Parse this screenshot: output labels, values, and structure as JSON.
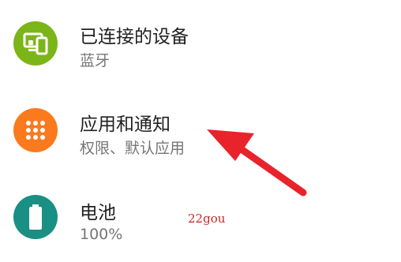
{
  "settings": {
    "items": [
      {
        "title": "已连接的设备",
        "subtitle": "蓝牙",
        "icon": "connected-devices-icon",
        "color": "#7cb518"
      },
      {
        "title": "应用和通知",
        "subtitle": "权限、默认应用",
        "icon": "apps-grid-icon",
        "color": "#fb7a1e"
      },
      {
        "title": "电池",
        "subtitle": "100%",
        "icon": "battery-icon",
        "color": "#1a8f84"
      }
    ]
  },
  "annotation": {
    "watermark": "22gou",
    "arrow_color": "#e8232c"
  }
}
